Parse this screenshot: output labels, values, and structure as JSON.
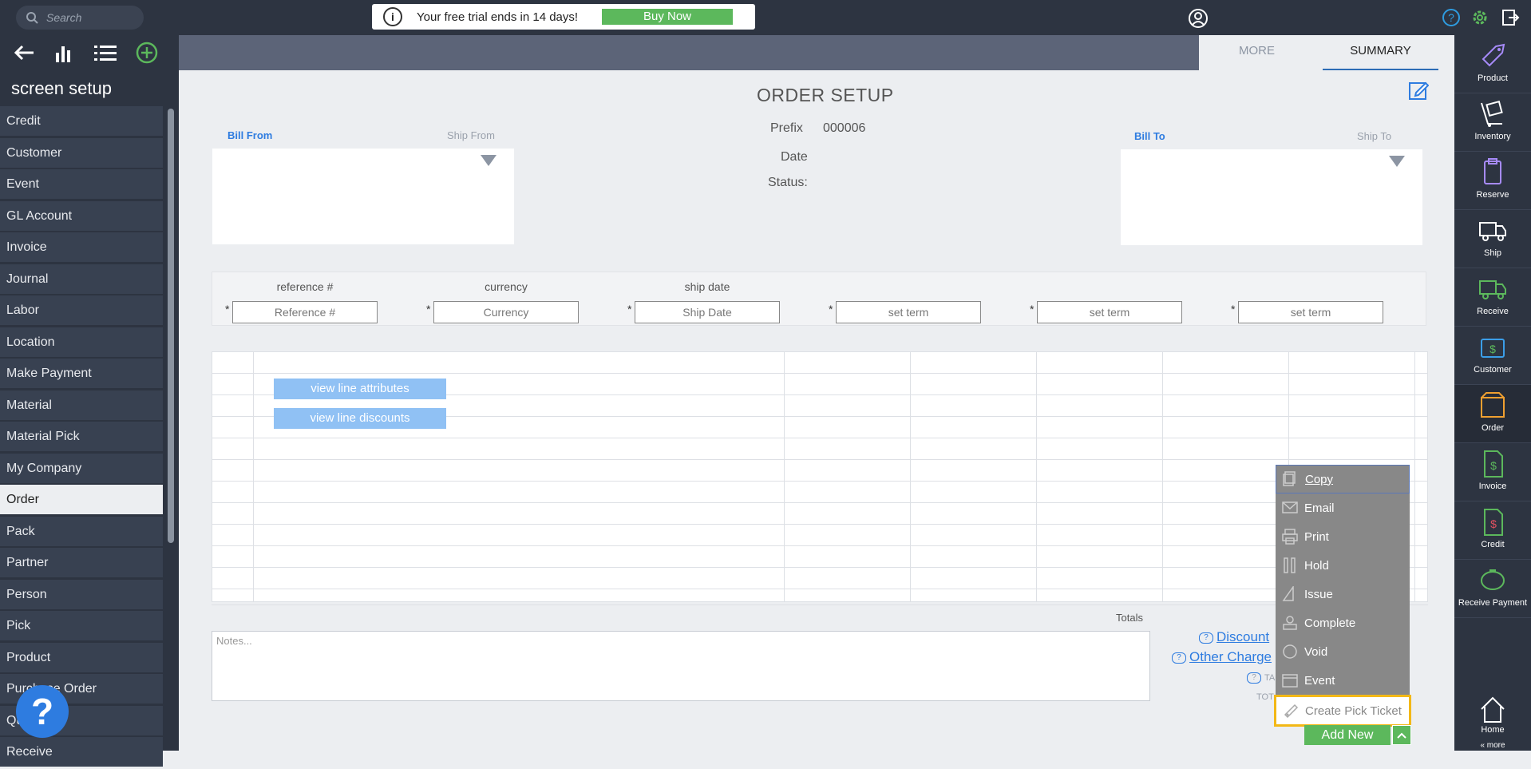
{
  "topbar": {
    "search_placeholder": "Search",
    "trial_text": "Your free trial ends in 14 days!",
    "buy_now": "Buy Now"
  },
  "sidebar": {
    "title": "screen setup",
    "items": [
      {
        "label": "Credit"
      },
      {
        "label": "Customer"
      },
      {
        "label": "Event"
      },
      {
        "label": "GL Account"
      },
      {
        "label": "Invoice"
      },
      {
        "label": "Journal"
      },
      {
        "label": "Labor"
      },
      {
        "label": "Location"
      },
      {
        "label": "Make Payment"
      },
      {
        "label": "Material"
      },
      {
        "label": "Material Pick"
      },
      {
        "label": "My Company"
      },
      {
        "label": "Order",
        "active": true
      },
      {
        "label": "Pack"
      },
      {
        "label": "Partner"
      },
      {
        "label": "Person"
      },
      {
        "label": "Pick"
      },
      {
        "label": "Product"
      },
      {
        "label": "Purchase Order"
      },
      {
        "label": "Qu..."
      },
      {
        "label": "Receive"
      }
    ]
  },
  "rightbar": {
    "items": [
      "Product",
      "Inventory",
      "Reserve",
      "Ship",
      "Receive",
      "Customer",
      "Order",
      "Invoice",
      "Credit",
      "Receive Payment"
    ],
    "home": "Home",
    "more": "« more"
  },
  "tabs": {
    "more": "MORE",
    "summary": "SUMMARY"
  },
  "form": {
    "title": "ORDER SETUP",
    "bill_from": "Bill From",
    "ship_from": "Ship From",
    "bill_to": "Bill To",
    "ship_to": "Ship To",
    "prefix_label": "Prefix",
    "prefix_value": "000006",
    "date_label": "Date",
    "status_label": "Status:"
  },
  "fields": [
    {
      "header": "reference #",
      "placeholder": "Reference #"
    },
    {
      "header": "currency",
      "placeholder": "Currency"
    },
    {
      "header": "ship date",
      "placeholder": "Ship Date"
    },
    {
      "header": "",
      "placeholder": "set term"
    },
    {
      "header": "",
      "placeholder": "set term"
    },
    {
      "header": "",
      "placeholder": "set term"
    }
  ],
  "grid": {
    "view_line_attributes": "view line attributes",
    "view_line_discounts": "view line discounts"
  },
  "totals": {
    "label": "Totals",
    "discount": "Discount",
    "other_charges": "Other Charge",
    "tax": "TA",
    "total": "TOT"
  },
  "notes_placeholder": "Notes...",
  "popup_menu": [
    "Copy",
    "Email",
    "Print",
    "Hold",
    "Issue",
    "Complete",
    "Void",
    "Event",
    "Create Pick Ticket"
  ],
  "add_new": "Add New",
  "help": "?"
}
